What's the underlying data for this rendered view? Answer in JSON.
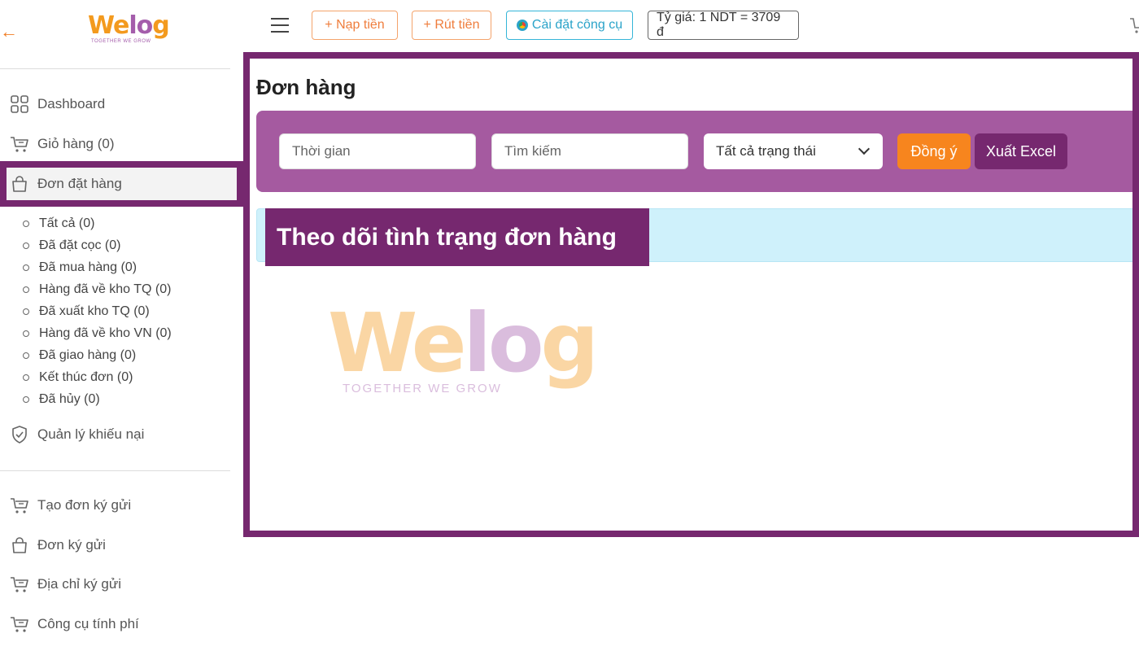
{
  "sidebar": {
    "back_icon": "arrow-left-icon",
    "logo": {
      "word_pre": "We",
      "word_o": "lo",
      "word_post": "g",
      "tagline": "TOGETHER WE GROW"
    },
    "items": [
      {
        "label": "Dashboard",
        "icon": "grid-icon"
      },
      {
        "label": "Giỏ hàng (0)",
        "icon": "cart-icon"
      },
      {
        "label": "Đơn đặt hàng",
        "icon": "bag-icon"
      },
      {
        "label": "Quản lý khiếu nại",
        "icon": "shield-check-icon"
      },
      {
        "label": "Tạo đơn ký gửi",
        "icon": "cart-icon"
      },
      {
        "label": "Đơn ký gửi",
        "icon": "bag-icon"
      },
      {
        "label": "Địa chỉ ký gửi",
        "icon": "cart-icon"
      },
      {
        "label": "Công cụ tính phí",
        "icon": "cart-icon"
      }
    ],
    "submenu": [
      "Tất cả (0)",
      "Đã đặt cọc (0)",
      "Đã mua hàng (0)",
      "Hàng đã về kho TQ (0)",
      "Đã xuất kho TQ (0)",
      "Hàng đã về kho VN (0)",
      "Đã giao hàng (0)",
      "Kết thúc đơn (0)",
      "Đã hủy (0)"
    ]
  },
  "topbar": {
    "nap_tien": "+ Nạp tiền",
    "rut_tien": "+ Rút tiền",
    "cai_dat": "Cài đặt công cụ",
    "ty_gia": "Tỷ giá: 1 NDT = 3709 đ"
  },
  "main": {
    "title": "Đơn hàng",
    "filters": {
      "time_placeholder": "Thời gian",
      "search_placeholder": "Tìm kiếm",
      "status_selected": "Tất cả trạng thái",
      "ok_label": "Đồng ý",
      "excel_label": "Xuất Excel"
    },
    "caption": "Theo dõi tình trạng đơn hàng",
    "watermark": {
      "word_pre": "We",
      "word_o": "lo",
      "word_post": "g",
      "tagline": "TOGETHER WE GROW"
    }
  },
  "colors": {
    "brand_purple": "#76286f",
    "filter_bg": "#a55aa0",
    "orange": "#f7851e",
    "info_bg": "#cff1fb"
  }
}
